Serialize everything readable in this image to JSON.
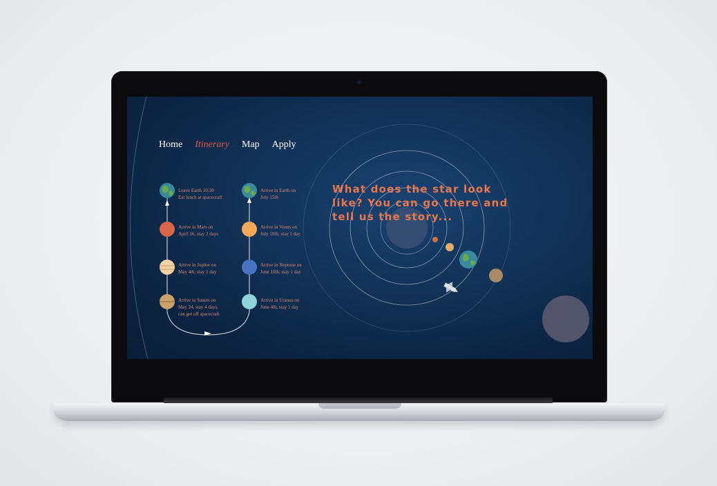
{
  "nav": {
    "items": [
      {
        "label": "Home"
      },
      {
        "label": "Itinerary"
      },
      {
        "label": "Map"
      },
      {
        "label": "Apply"
      }
    ],
    "active": "Itinerary"
  },
  "itinerary": {
    "left_column": [
      {
        "line1": "Leave Earth 10:30",
        "line2": "Eat lunch at spacecraft",
        "line3": ""
      },
      {
        "line1": "Arrive in Mars on",
        "line2": "April 16, stay 2 days",
        "line3": ""
      },
      {
        "line1": "Arrive in Jupiter on",
        "line2": "May 4th, stay 1 day",
        "line3": ""
      },
      {
        "line1": "Arrive in Saturn on",
        "line2": "May 24, stay 4 days,",
        "line3": "can get off spacecraft"
      }
    ],
    "right_column": [
      {
        "line1": "Arrive in Earth on",
        "line2": "July 15th"
      },
      {
        "line1": "Arrive in Venus on",
        "line2": "July 10th, stay 1 day"
      },
      {
        "line1": "Arrive in Neptune on",
        "line2": "June 10th, stay 1 day"
      },
      {
        "line1": "Arrive in Uranus on",
        "line2": "June 4th, stay 1 day"
      }
    ]
  },
  "hero": {
    "headline": "What does the star look like? You can go there and tell us the story..."
  },
  "colors": {
    "accent": "#e2584f",
    "headline": "#e8774e",
    "screen_bg": "#123257",
    "mars": "#d9654a",
    "jupiter": "#f2d3a8",
    "saturn": "#c9a26a",
    "venus": "#f5a85a",
    "neptune": "#4a72c2",
    "uranus": "#8fd3d8",
    "earth": "#3a8a9e"
  }
}
